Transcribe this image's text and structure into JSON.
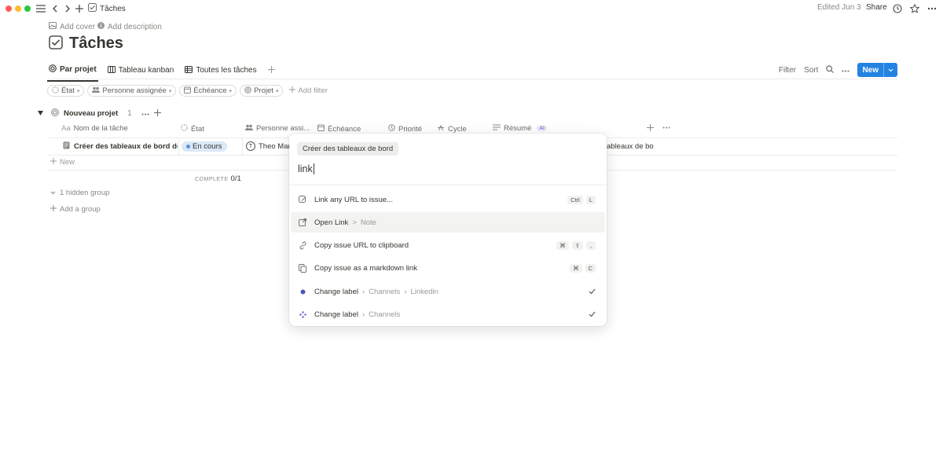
{
  "titlebar": {
    "breadcrumb": "Tâches",
    "edited": "Edited Jun 3",
    "share": "Share"
  },
  "page": {
    "add_cover": "Add cover",
    "add_description": "Add description",
    "title": "Tâches"
  },
  "tabs": [
    {
      "label": "Par projet",
      "active": true
    },
    {
      "label": "Tableau kanban",
      "active": false
    },
    {
      "label": "Toutes les tâches",
      "active": false
    }
  ],
  "toolbar": {
    "filter": "Filter",
    "sort": "Sort",
    "new": "New"
  },
  "filters": [
    {
      "label": "État"
    },
    {
      "label": "Personne assignée"
    },
    {
      "label": "Échéance"
    },
    {
      "label": "Projet"
    }
  ],
  "add_filter": "Add filter",
  "group": {
    "name": "Nouveau projet",
    "count": "1"
  },
  "columns": [
    {
      "label": "Nom de la tâche",
      "prefix": "Aa"
    },
    {
      "label": "État"
    },
    {
      "label": "Personne assi..."
    },
    {
      "label": "Échéance"
    },
    {
      "label": "Priorité"
    },
    {
      "label": "Cycle"
    },
    {
      "label": "Résumé",
      "badge": "AI"
    }
  ],
  "row": {
    "task": "Créer des tableaux de bord de c",
    "status": "En cours",
    "assignee_initial": "T",
    "assignee": "Theo Mar",
    "summary_fragment": "ableaux de bo"
  },
  "new_row": "New",
  "complete": {
    "label": "COMPLETE",
    "value": "0/1"
  },
  "hidden_group": "1 hidden group",
  "add_group": "Add a group",
  "popup": {
    "context_tag": "Créer des tableaux de bord",
    "query": "link",
    "commands": [
      {
        "label": "Link any URL to issue...",
        "keys": [
          "Ctrl",
          "L"
        ]
      },
      {
        "label": "Open Link",
        "sub": "Note",
        "keys": []
      },
      {
        "label": "Copy issue URL to clipboard",
        "keys": [
          "⌘",
          "⇧",
          ","
        ]
      },
      {
        "label": "Copy issue as a markdown link",
        "keys": [
          "⌘",
          "C"
        ]
      },
      {
        "label": "Change label",
        "path1": "Channels",
        "path2": "Linkedin",
        "keys": []
      },
      {
        "label": "Change label",
        "path1": "Channels",
        "keys": []
      }
    ]
  },
  "colors": {
    "accent": "#2383e2",
    "status_bg": "#dbe8f6",
    "status_dot": "#5a8fd8",
    "label_dot_1": "#4b55b8",
    "label_dot_2": "#6a5ad8"
  }
}
